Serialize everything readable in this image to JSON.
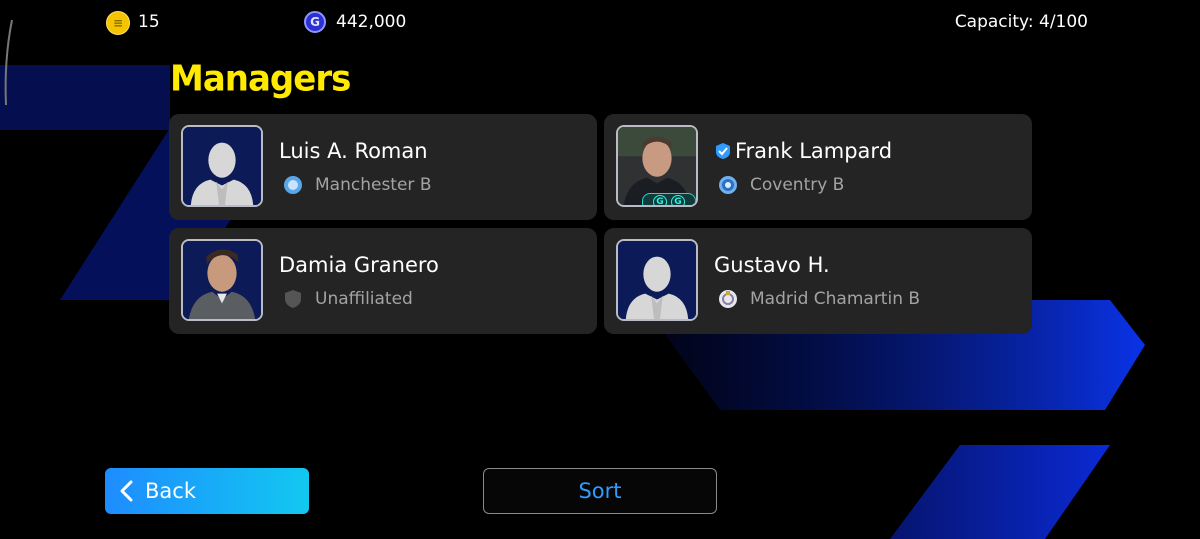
{
  "currency": {
    "coins": {
      "icon": "ecoin-icon",
      "value": "15"
    },
    "gp": {
      "icon": "gp-icon",
      "value": "442,000"
    }
  },
  "capacity": "Capacity: 4/100",
  "page_title": "Managers",
  "managers": [
    {
      "name": "Luis A. Roman",
      "club": "Manchester B",
      "portrait": "silhouette",
      "verified": false
    },
    {
      "name": "Frank Lampard",
      "club": "Coventry B",
      "portrait": "photo",
      "verified": true
    },
    {
      "name": "Damia Granero",
      "club": "Unaffiliated",
      "portrait": "photo",
      "verified": false
    },
    {
      "name": "Gustavo H.",
      "club": "Madrid Chamartin B",
      "portrait": "silhouette",
      "verified": false
    }
  ],
  "buttons": {
    "back": "Back",
    "sort": "Sort"
  },
  "colors": {
    "title": "#ffea00",
    "accent_blue": "#1e8cff",
    "sort_text": "#2f9bff",
    "card_bg": "#242424"
  }
}
